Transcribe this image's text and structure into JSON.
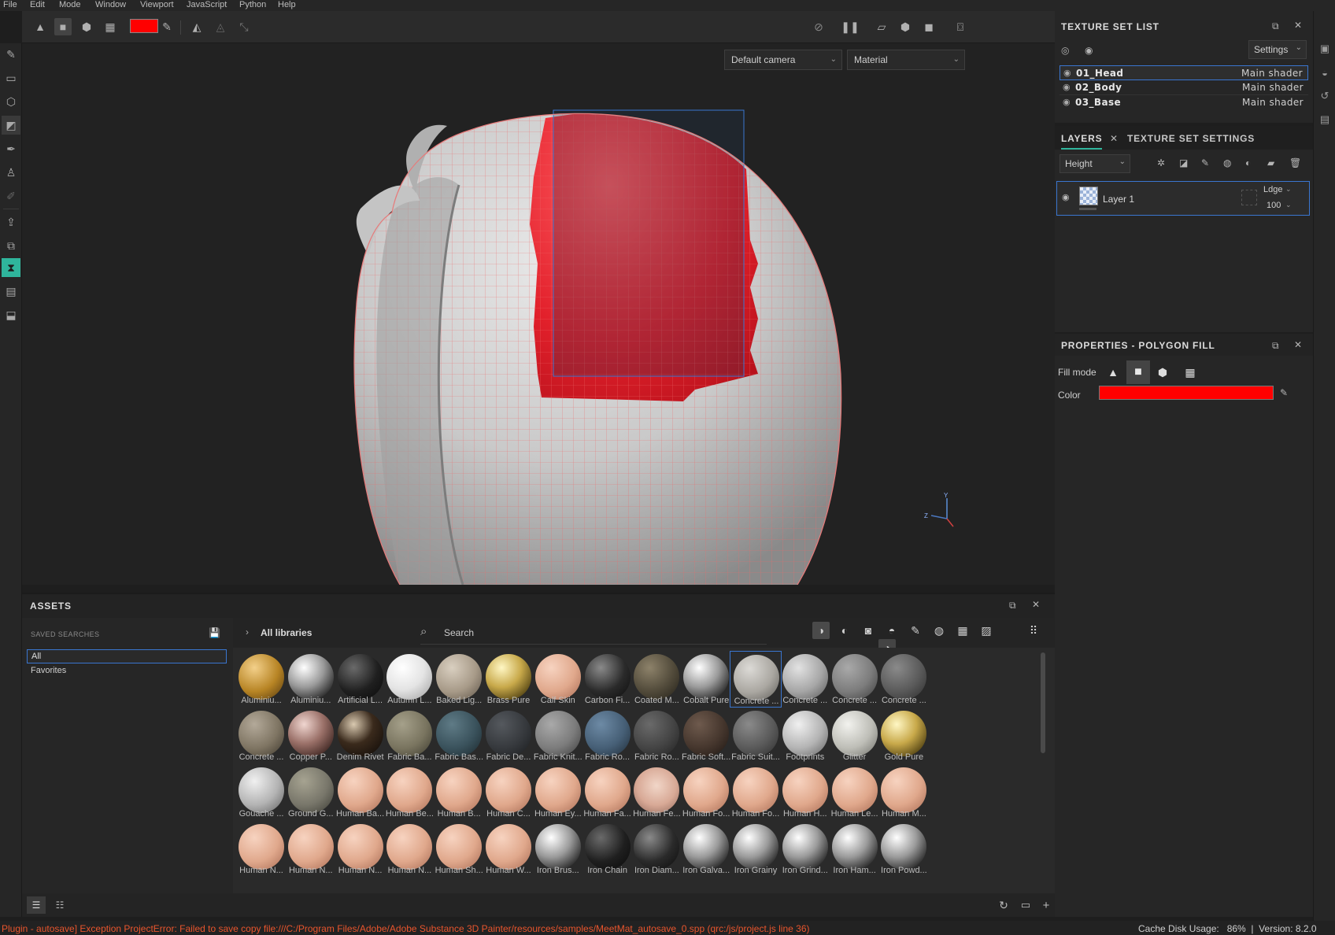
{
  "menu": [
    "File",
    "Edit",
    "Mode",
    "Window",
    "Viewport",
    "JavaScript",
    "Python",
    "Help"
  ],
  "colors": {
    "accent": "#2fb59c",
    "fill_red": "#ff0000",
    "select_blue": "#3a76d0",
    "error": "#e8552d"
  },
  "toolbar": {
    "icons": [
      "triangle-mode-icon",
      "square-mode-icon",
      "cube-mode-icon",
      "checker-mode-icon",
      "color-swatch",
      "picker-icon",
      "mirror-icon",
      "mirror-off-icon",
      "transform-icon"
    ],
    "right_icons": [
      "hide-icon",
      "pause-icon",
      "view-2d-icon",
      "view-3d-icon",
      "camera-icon",
      "screenshot-icon"
    ]
  },
  "viewport": {
    "camera_select": "Default camera",
    "mode_select": "Material",
    "gizmo": {
      "y": "Y",
      "z": "Z"
    }
  },
  "texture_set_list": {
    "title": "TEXTURE SET LIST",
    "settings_label": "Settings",
    "rows": [
      {
        "name": "01_Head",
        "shader": "Main shader",
        "selected": true
      },
      {
        "name": "02_Body",
        "shader": "Main shader",
        "selected": false
      },
      {
        "name": "03_Base",
        "shader": "Main shader",
        "selected": false
      }
    ]
  },
  "layers": {
    "tab_layers": "LAYERS",
    "tab_tss": "TEXTURE SET SETTINGS",
    "channel": "Height",
    "layer": {
      "name": "Layer 1",
      "blend": "Ldge",
      "opacity": "100"
    }
  },
  "properties": {
    "title": "PROPERTIES - POLYGON FILL",
    "fill_mode_label": "Fill mode",
    "color_label": "Color"
  },
  "assets": {
    "title": "ASSETS",
    "saved_searches": "SAVED SEARCHES",
    "list": [
      "All",
      "Favorites"
    ],
    "breadcrumb": "All libraries",
    "search_placeholder": "Search",
    "items": [
      {
        "label": "Aluminiu...",
        "tone": "gold-scaly"
      },
      {
        "label": "Aluminiu...",
        "tone": "chrome"
      },
      {
        "label": "Artificial L...",
        "tone": "black"
      },
      {
        "label": "Autumn L...",
        "tone": "leaf"
      },
      {
        "label": "Baked Lig...",
        "tone": "tan"
      },
      {
        "label": "Brass Pure",
        "tone": "gold"
      },
      {
        "label": "Calf Skin",
        "tone": "skin"
      },
      {
        "label": "Carbon Fi...",
        "tone": "carbon"
      },
      {
        "label": "Coated M...",
        "tone": "olive-dark"
      },
      {
        "label": "Cobalt Pure",
        "tone": "chrome"
      },
      {
        "label": "Concrete ...",
        "tone": "concrete-light"
      },
      {
        "label": "Concrete ...",
        "tone": "grey-light"
      },
      {
        "label": "Concrete ...",
        "tone": "grey"
      },
      {
        "label": "Concrete ...",
        "tone": "grey-dark"
      },
      {
        "label": "Concrete ...",
        "tone": "tan-grey"
      },
      {
        "label": "Copper P...",
        "tone": "copper"
      },
      {
        "label": "Denim Rivet",
        "tone": "rivet"
      },
      {
        "label": "Fabric Ba...",
        "tone": "khaki"
      },
      {
        "label": "Fabric Bas...",
        "tone": "teal-dark"
      },
      {
        "label": "Fabric De...",
        "tone": "slate"
      },
      {
        "label": "Fabric Knit...",
        "tone": "grey"
      },
      {
        "label": "Fabric Ro...",
        "tone": "blue-grey"
      },
      {
        "label": "Fabric Ro...",
        "tone": "charcoal"
      },
      {
        "label": "Fabric Soft...",
        "tone": "brown-dark"
      },
      {
        "label": "Fabric Suit...",
        "tone": "grey-dark"
      },
      {
        "label": "Footprints",
        "tone": "white-grey"
      },
      {
        "label": "Glitter",
        "tone": "glitter"
      },
      {
        "label": "Gold Pure",
        "tone": "gold"
      },
      {
        "label": "Gouache ...",
        "tone": "white-grey"
      },
      {
        "label": "Ground G...",
        "tone": "moss"
      },
      {
        "label": "Human Ba...",
        "tone": "skin"
      },
      {
        "label": "Human Be...",
        "tone": "skin"
      },
      {
        "label": "Human B...",
        "tone": "skin"
      },
      {
        "label": "Human C...",
        "tone": "skin"
      },
      {
        "label": "Human Ey...",
        "tone": "skin"
      },
      {
        "label": "Human Fa...",
        "tone": "skin"
      },
      {
        "label": "Human Fe...",
        "tone": "face"
      },
      {
        "label": "Human Fo...",
        "tone": "skin"
      },
      {
        "label": "Human Fo...",
        "tone": "skin"
      },
      {
        "label": "Human H...",
        "tone": "skin"
      },
      {
        "label": "Human Le...",
        "tone": "skin"
      },
      {
        "label": "Human M...",
        "tone": "skin"
      },
      {
        "label": "Human N...",
        "tone": "skin"
      },
      {
        "label": "Human N...",
        "tone": "skin"
      },
      {
        "label": "Human N...",
        "tone": "skin"
      },
      {
        "label": "Human N...",
        "tone": "skin"
      },
      {
        "label": "Human Sh...",
        "tone": "skin"
      },
      {
        "label": "Human W...",
        "tone": "skin"
      },
      {
        "label": "Iron Brus...",
        "tone": "chrome"
      },
      {
        "label": "Iron Chain",
        "tone": "black"
      },
      {
        "label": "Iron Diam...",
        "tone": "carbon"
      },
      {
        "label": "Iron Galva...",
        "tone": "chrome"
      },
      {
        "label": "Iron Grainy",
        "tone": "chrome"
      },
      {
        "label": "Iron Grind...",
        "tone": "chrome"
      },
      {
        "label": "Iron Ham...",
        "tone": "chrome"
      },
      {
        "label": "Iron Powd...",
        "tone": "chrome"
      }
    ]
  },
  "status": {
    "error": "Plugin - autosave] Exception ProjectError: Failed to save copy file:///C:/Program Files/Adobe/Adobe Substance 3D Painter/resources/samples/MeetMat_autosave_0.spp (qrc:/js/project.js line 36)",
    "cache": "Cache Disk Usage:   86%  |  Version: 8.2.0"
  }
}
